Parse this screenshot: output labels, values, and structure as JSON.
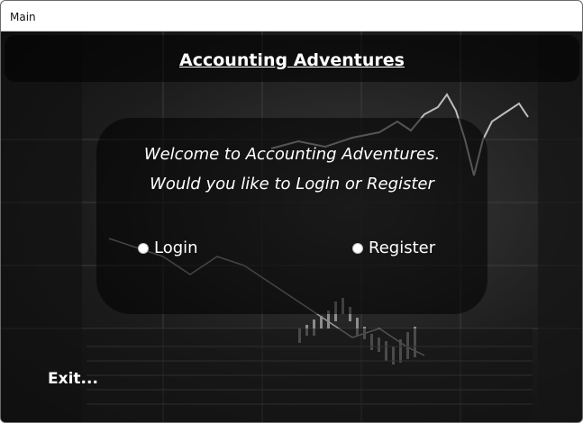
{
  "window": {
    "title": "Main"
  },
  "header": {
    "title": "Accounting Adventures"
  },
  "panel": {
    "welcome_line1": "Welcome to Accounting Adventures.",
    "welcome_line2": "Would you like to Login or Register",
    "options": [
      {
        "label": "Login",
        "selected": false
      },
      {
        "label": "Register",
        "selected": false
      }
    ]
  },
  "footer": {
    "exit_label": "Exit..."
  },
  "colors": {
    "text": "#ffffff",
    "background": "#1c1c1c",
    "overlay": "#000000"
  }
}
